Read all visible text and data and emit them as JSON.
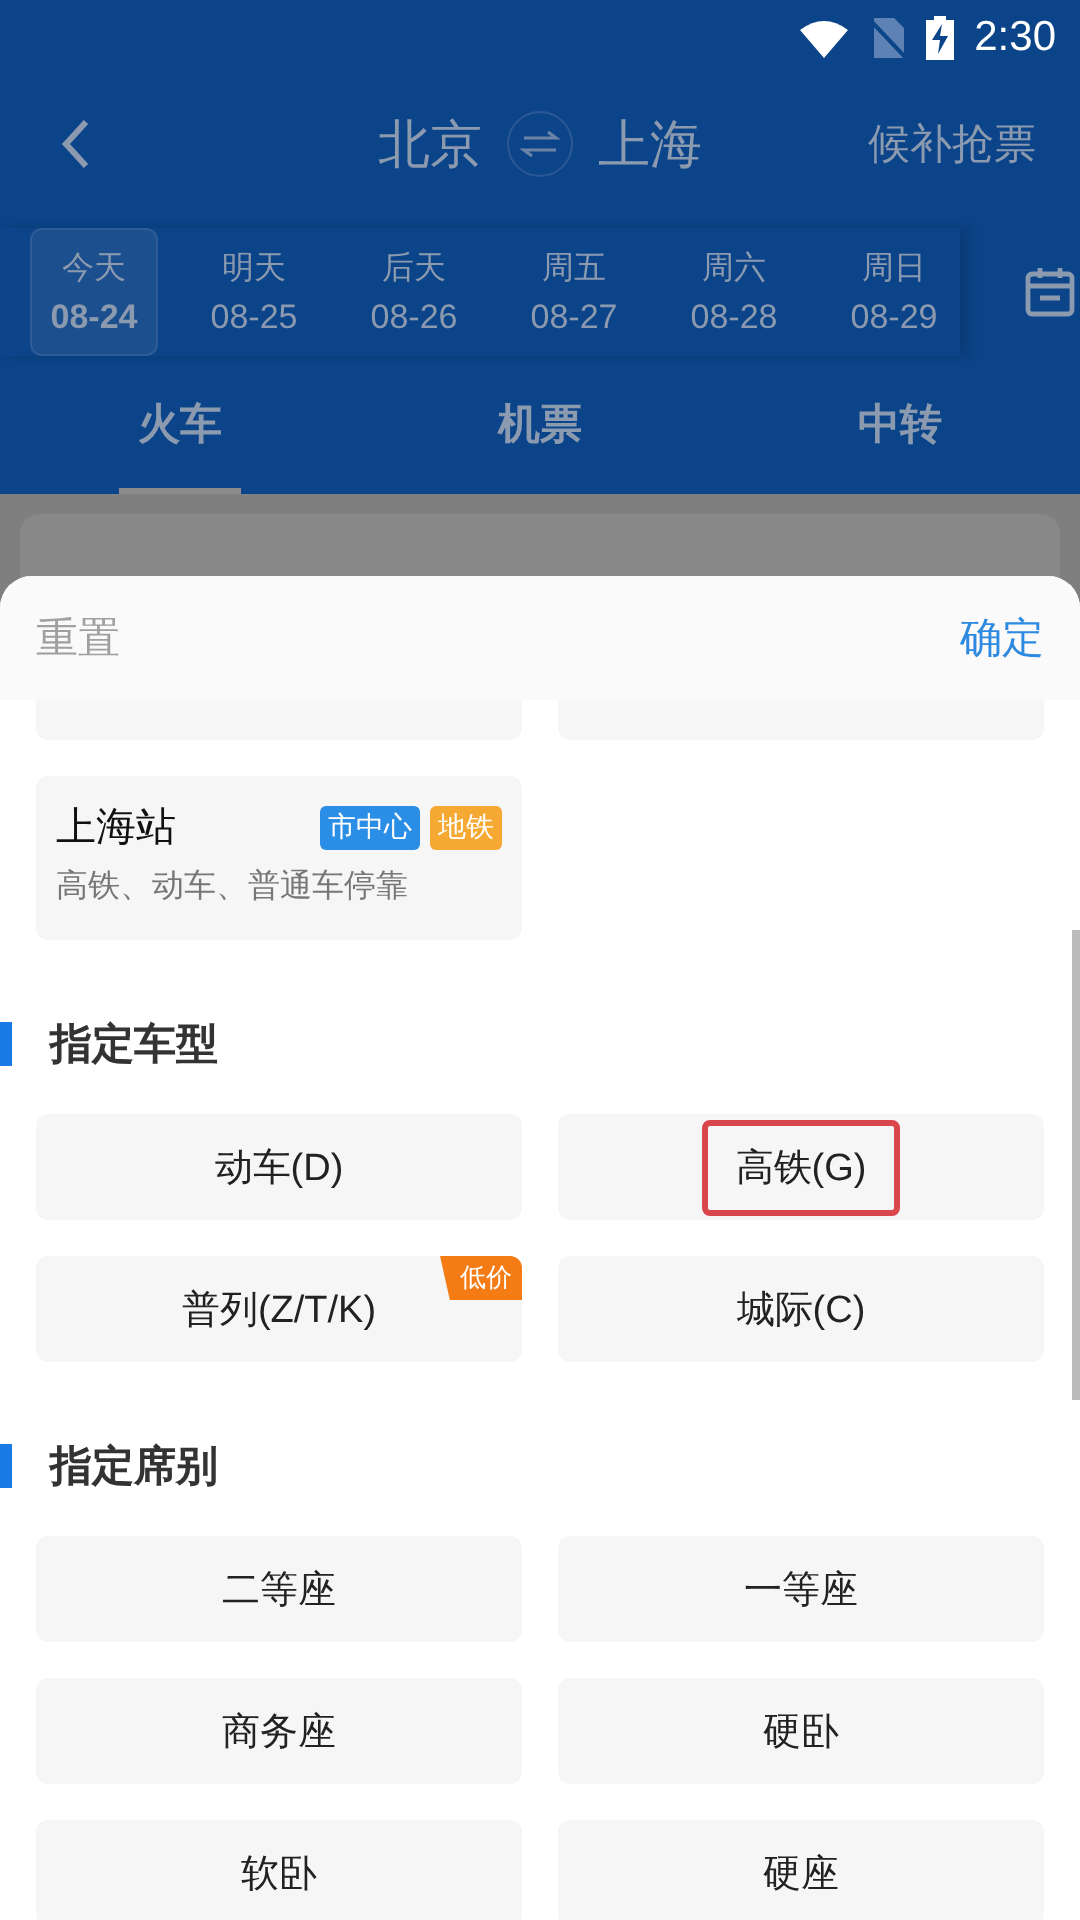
{
  "status_bar": {
    "time": "2:30"
  },
  "header": {
    "from": "北京",
    "to": "上海",
    "action": "候补抢票"
  },
  "dates": [
    {
      "weekday": "今天",
      "date": "08-24",
      "selected": true
    },
    {
      "weekday": "明天",
      "date": "08-25",
      "selected": false
    },
    {
      "weekday": "后天",
      "date": "08-26",
      "selected": false
    },
    {
      "weekday": "周五",
      "date": "08-27",
      "selected": false
    },
    {
      "weekday": "周六",
      "date": "08-28",
      "selected": false
    },
    {
      "weekday": "周日",
      "date": "08-29",
      "selected": false
    }
  ],
  "tabs": [
    {
      "label": "火车",
      "selected": true
    },
    {
      "label": "机票",
      "selected": false
    },
    {
      "label": "中转",
      "selected": false
    }
  ],
  "filter_sheet": {
    "reset": "重置",
    "confirm": "确定",
    "stations": [
      {
        "name": "上海站",
        "tags": [
          {
            "label": "市中心",
            "color": "#2b8ee6"
          },
          {
            "label": "地铁",
            "color": "#f5a832"
          }
        ],
        "note": "高铁、动车、普通车停靠"
      }
    ],
    "sections": [
      {
        "title": "指定车型",
        "options": [
          {
            "label": "动车(D)",
            "highlighted": false
          },
          {
            "label": "高铁(G)",
            "highlighted": true
          },
          {
            "label": "普列(Z/T/K)",
            "tag": "低价",
            "highlighted": false
          },
          {
            "label": "城际(C)",
            "highlighted": false
          }
        ]
      },
      {
        "title": "指定席别",
        "options": [
          {
            "label": "二等座",
            "highlighted": false
          },
          {
            "label": "一等座",
            "highlighted": false
          },
          {
            "label": "商务座",
            "highlighted": false
          },
          {
            "label": "硬卧",
            "highlighted": false
          },
          {
            "label": "软卧",
            "highlighted": false
          },
          {
            "label": "硬座",
            "highlighted": false
          }
        ]
      }
    ]
  }
}
